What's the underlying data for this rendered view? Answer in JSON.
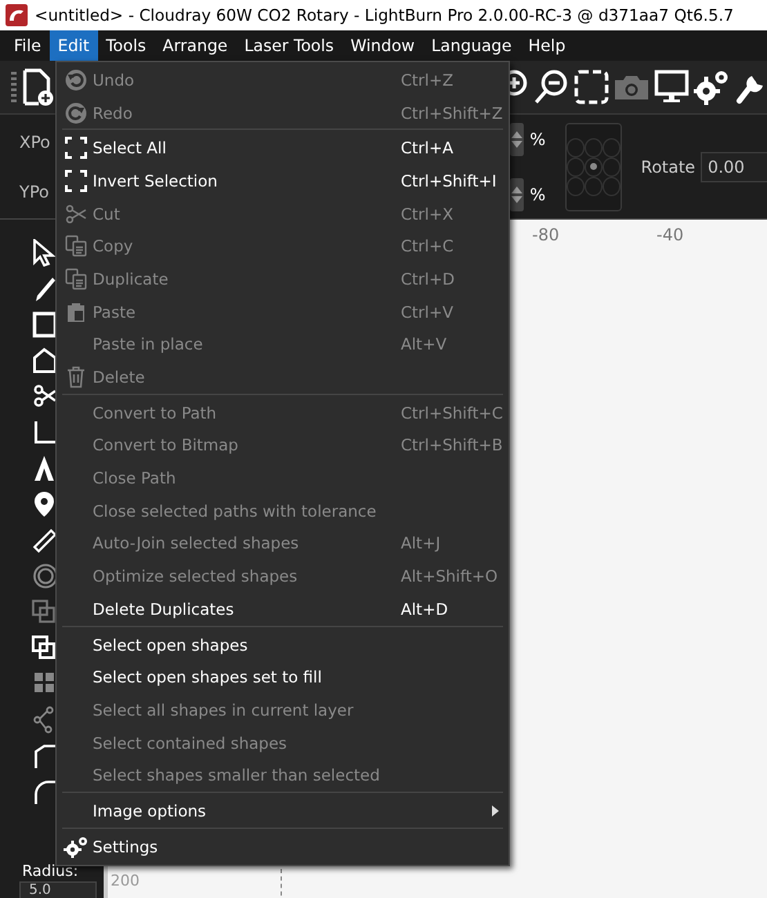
{
  "window": {
    "title": "<untitled> - Cloudray 60W CO2 Rotary - LightBurn Pro 2.0.00-RC-3 @ d371aa7 Qt6.5.7"
  },
  "menu_bar": [
    {
      "label": "File",
      "selected": false
    },
    {
      "label": "Edit",
      "selected": true
    },
    {
      "label": "Tools",
      "selected": false
    },
    {
      "label": "Arrange",
      "selected": false
    },
    {
      "label": "Laser Tools",
      "selected": false
    },
    {
      "label": "Window",
      "selected": false
    },
    {
      "label": "Language",
      "selected": false
    },
    {
      "label": "Help",
      "selected": false
    }
  ],
  "toolbar": {
    "tools": [
      {
        "kind": "zoom-in",
        "disabled": false
      },
      {
        "kind": "zoom-out",
        "disabled": false
      },
      {
        "kind": "frame",
        "disabled": false
      },
      {
        "kind": "camera",
        "disabled": true
      },
      {
        "kind": "monitor",
        "disabled": false
      },
      {
        "kind": "gear",
        "disabled": false
      },
      {
        "kind": "wrench",
        "disabled": false
      }
    ]
  },
  "properties": {
    "xpos_label": "XPo",
    "ypos_label": "YPo",
    "units": [
      "%",
      "%"
    ],
    "origin_grid": [
      {
        "selected": false
      },
      {
        "selected": false
      },
      {
        "selected": false
      },
      {
        "selected": false
      },
      {
        "selected": true
      },
      {
        "selected": false
      },
      {
        "selected": false
      },
      {
        "selected": false
      },
      {
        "selected": false
      }
    ],
    "rotate_label": "Rotate",
    "rotate_value": "0.00"
  },
  "ruler": {
    "x_labels": [
      "-80",
      "-40"
    ],
    "y_label": "200"
  },
  "toolbox": {
    "radius_label": "Radius:",
    "radius_value": "5.0"
  },
  "edit_menu": {
    "items": [
      {
        "kind": "item",
        "label": "Undo",
        "shortcut": "Ctrl+Z",
        "disabled": true
      },
      {
        "kind": "item",
        "label": "Redo",
        "shortcut": "Ctrl+Shift+Z",
        "disabled": true
      },
      {
        "kind": "separator"
      },
      {
        "kind": "item",
        "label": "Select All",
        "shortcut": "Ctrl+A",
        "disabled": false
      },
      {
        "kind": "item",
        "label": "Invert Selection",
        "shortcut": "Ctrl+Shift+I",
        "disabled": false
      },
      {
        "kind": "item",
        "label": "Cut",
        "shortcut": "Ctrl+X",
        "disabled": true
      },
      {
        "kind": "item",
        "label": "Copy",
        "shortcut": "Ctrl+C",
        "disabled": true
      },
      {
        "kind": "item",
        "label": "Duplicate",
        "shortcut": "Ctrl+D",
        "disabled": true
      },
      {
        "kind": "item",
        "label": "Paste",
        "shortcut": "Ctrl+V",
        "disabled": true
      },
      {
        "kind": "item",
        "label": "Paste in place",
        "shortcut": "Alt+V",
        "disabled": true
      },
      {
        "kind": "item",
        "label": "Delete",
        "disabled": true
      },
      {
        "kind": "separator"
      },
      {
        "kind": "item",
        "label": "Convert to Path",
        "shortcut": "Ctrl+Shift+C",
        "disabled": true
      },
      {
        "kind": "item",
        "label": "Convert to Bitmap",
        "shortcut": "Ctrl+Shift+B",
        "disabled": true
      },
      {
        "kind": "item",
        "label": "Close Path",
        "disabled": true
      },
      {
        "kind": "item",
        "label": "Close selected paths with tolerance",
        "disabled": true
      },
      {
        "kind": "item",
        "label": "Auto-Join selected shapes",
        "shortcut": "Alt+J",
        "disabled": true
      },
      {
        "kind": "item",
        "label": "Optimize selected shapes",
        "shortcut": "Alt+Shift+O",
        "disabled": true
      },
      {
        "kind": "item",
        "label": "Delete Duplicates",
        "shortcut": "Alt+D",
        "disabled": false
      },
      {
        "kind": "separator"
      },
      {
        "kind": "item",
        "label": "Select open shapes",
        "disabled": false
      },
      {
        "kind": "item",
        "label": "Select open shapes set to fill",
        "disabled": false
      },
      {
        "kind": "item",
        "label": "Select all shapes in current layer",
        "disabled": true
      },
      {
        "kind": "item",
        "label": "Select contained shapes",
        "disabled": true
      },
      {
        "kind": "item",
        "label": "Select shapes smaller than selected",
        "disabled": true
      },
      {
        "kind": "separator"
      },
      {
        "kind": "item",
        "label": "Image options",
        "disabled": false,
        "submenu": true
      },
      {
        "kind": "separator"
      },
      {
        "kind": "item",
        "label": "Settings",
        "disabled": false
      }
    ]
  }
}
